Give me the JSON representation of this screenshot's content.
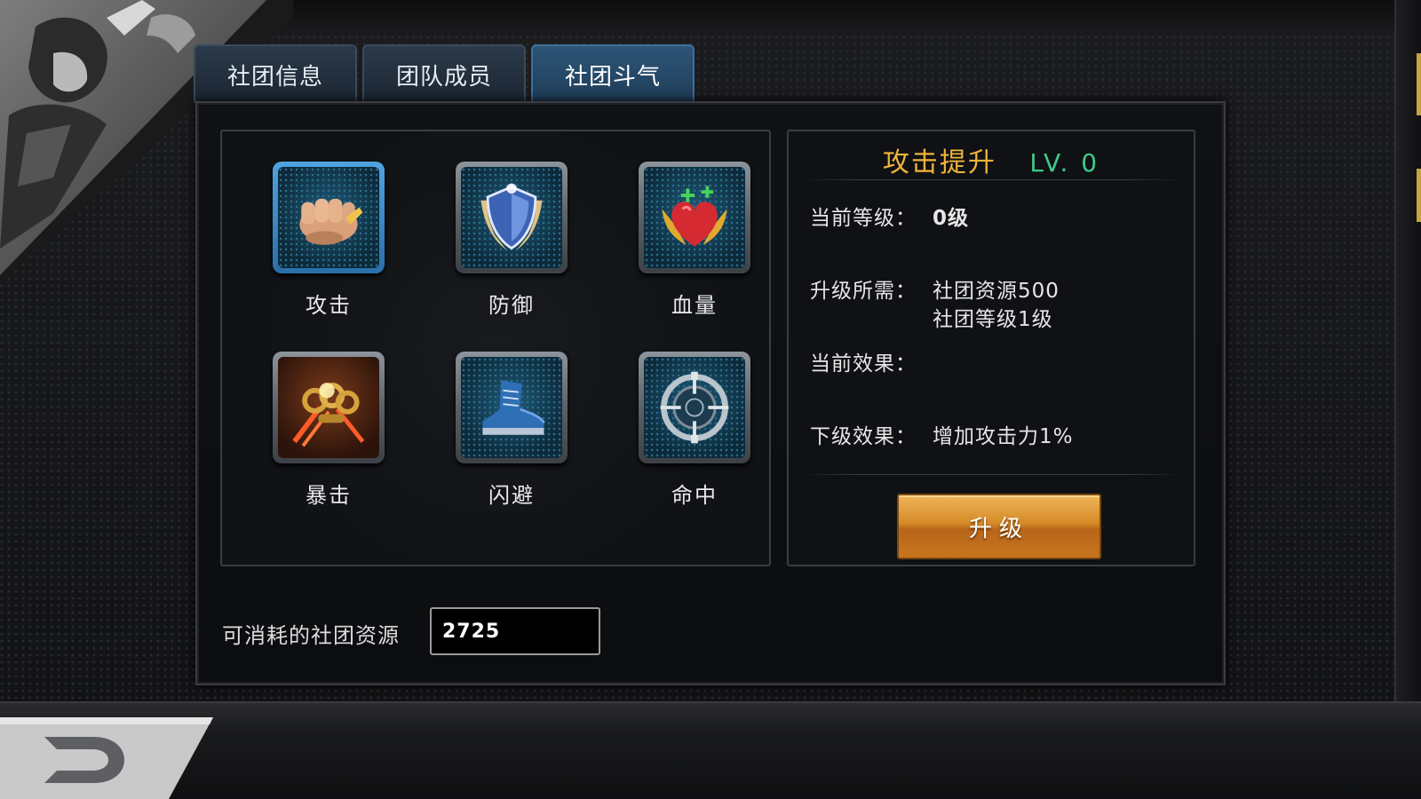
{
  "tabs": [
    {
      "label": "社团信息",
      "active": false
    },
    {
      "label": "团队成员",
      "active": false
    },
    {
      "label": "社团斗气",
      "active": true
    }
  ],
  "skills": [
    {
      "label": "攻击",
      "icon": "fist-icon",
      "selected": true
    },
    {
      "label": "防御",
      "icon": "shield-icon",
      "selected": false
    },
    {
      "label": "血量",
      "icon": "heart-icon",
      "selected": false
    },
    {
      "label": "暴击",
      "icon": "knuckles-icon",
      "selected": false
    },
    {
      "label": "闪避",
      "icon": "boot-icon",
      "selected": false
    },
    {
      "label": "命中",
      "icon": "crosshair-icon",
      "selected": false
    }
  ],
  "detail": {
    "name": "攻击提升",
    "level": "LV. 0",
    "current_level_label": "当前等级：",
    "current_level_value": "0级",
    "upgrade_req_label": "升级所需：",
    "upgrade_req_line1": "社团资源500",
    "upgrade_req_line2": "社团等级1级",
    "current_effect_label": "当前效果：",
    "current_effect_value": "",
    "next_effect_label": "下级效果：",
    "next_effect_value": "增加攻击力1%",
    "upgrade_button": "升级"
  },
  "resource": {
    "label": "可消耗的社团资源",
    "value": "2725"
  },
  "colors": {
    "title_gold": "#f0b43a",
    "level_green": "#3ec98a",
    "button_orange": "#d58a26",
    "tab_active": "#2d5577"
  }
}
